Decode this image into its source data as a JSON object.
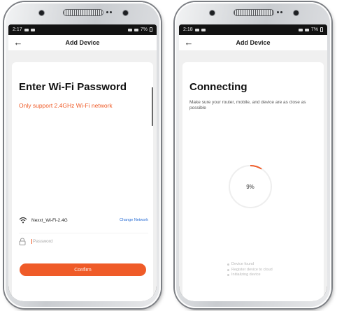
{
  "screen_left": {
    "status_time": "2:17",
    "status_battery": "7%",
    "header_title": "Add Device",
    "back_icon": "back-arrow-icon",
    "title": "Enter Wi-Fi Password",
    "subtitle": "Only support 2.4GHz Wi-Fi network",
    "wifi_name": "Nexxt_Wi-Fi-2.4G",
    "change_network": "Change Network",
    "password_placeholder": "Password",
    "password_value": "",
    "confirm_label": "Confirm",
    "accent_color": "#ef5b28"
  },
  "screen_right": {
    "status_time": "2:18",
    "status_battery": "7%",
    "header_title": "Add Device",
    "back_icon": "back-arrow-icon",
    "title": "Connecting",
    "subtitle": "Make sure your router, mobile, and device are as close as possible",
    "progress_text": "9%",
    "progress_value": 0.09,
    "steps": [
      "Device found",
      "Register device to cloud",
      "Initializing device"
    ]
  }
}
